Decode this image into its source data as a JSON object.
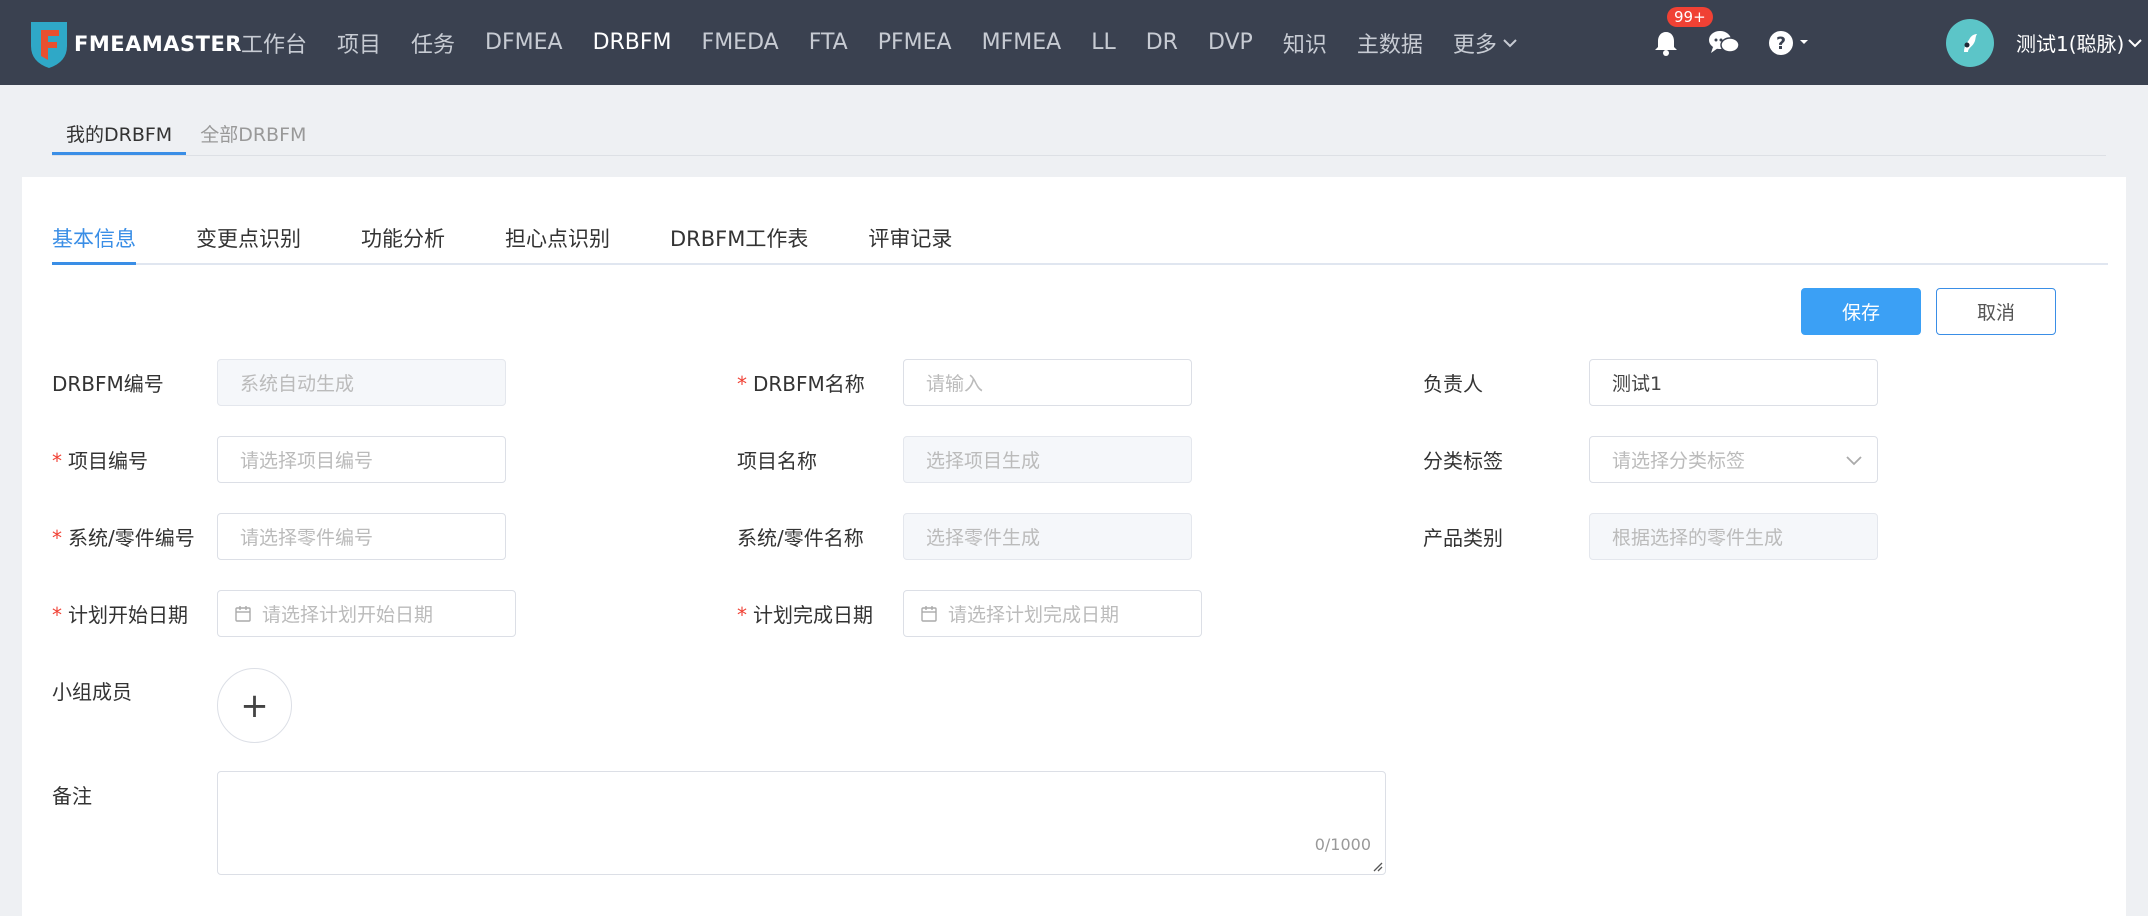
{
  "app": {
    "brand": "FMEAMASTER"
  },
  "nav": {
    "items": [
      "工作台",
      "项目",
      "任务",
      "DFMEA",
      "DRBFM",
      "FMEDA",
      "FTA",
      "PFMEA",
      "MFMEA",
      "LL",
      "DR",
      "DVP",
      "知识",
      "主数据"
    ],
    "active": "DRBFM",
    "more_label": "更多",
    "notification_badge": "99+",
    "user_name": "测试1(聪脉)"
  },
  "subtabs": [
    "我的DRBFM",
    "全部DRBFM"
  ],
  "tabs": [
    "基本信息",
    "变更点识别",
    "功能分析",
    "担心点识别",
    "DRBFM工作表",
    "评审记录"
  ],
  "buttons": {
    "save": "保存",
    "cancel": "取消"
  },
  "form": {
    "drbfm_no": {
      "label": "DRBFM编号",
      "placeholder": "系统自动生成"
    },
    "drbfm_name": {
      "label": "DRBFM名称",
      "placeholder": "请输入",
      "required": true
    },
    "owner": {
      "label": "负责人",
      "value": "测试1"
    },
    "project_no": {
      "label": "项目编号",
      "placeholder": "请选择项目编号",
      "required": true
    },
    "project_name": {
      "label": "项目名称",
      "placeholder": "选择项目生成"
    },
    "tag": {
      "label": "分类标签",
      "placeholder": "请选择分类标签"
    },
    "part_no": {
      "label": "系统/零件编号",
      "placeholder": "请选择零件编号",
      "required": true
    },
    "part_name": {
      "label": "系统/零件名称",
      "placeholder": "选择零件生成"
    },
    "product_type": {
      "label": "产品类别",
      "placeholder": "根据选择的零件生成"
    },
    "plan_start": {
      "label": "计划开始日期",
      "placeholder": "请选择计划开始日期",
      "required": true
    },
    "plan_end": {
      "label": "计划完成日期",
      "placeholder": "请选择计划完成日期",
      "required": true
    },
    "members": {
      "label": "小组成员",
      "add_symbol": "+"
    },
    "remark": {
      "label": "备注",
      "counter": "0/1000"
    }
  },
  "colors": {
    "nav_bg": "#3a4150",
    "primary": "#3ba0f5",
    "required": "#f04134",
    "badge": "#f04134",
    "avatar": "#5cc5c8"
  },
  "icons": [
    "bell-icon",
    "chat-icon",
    "help-icon",
    "calendar-icon",
    "chevron-down-icon"
  ]
}
